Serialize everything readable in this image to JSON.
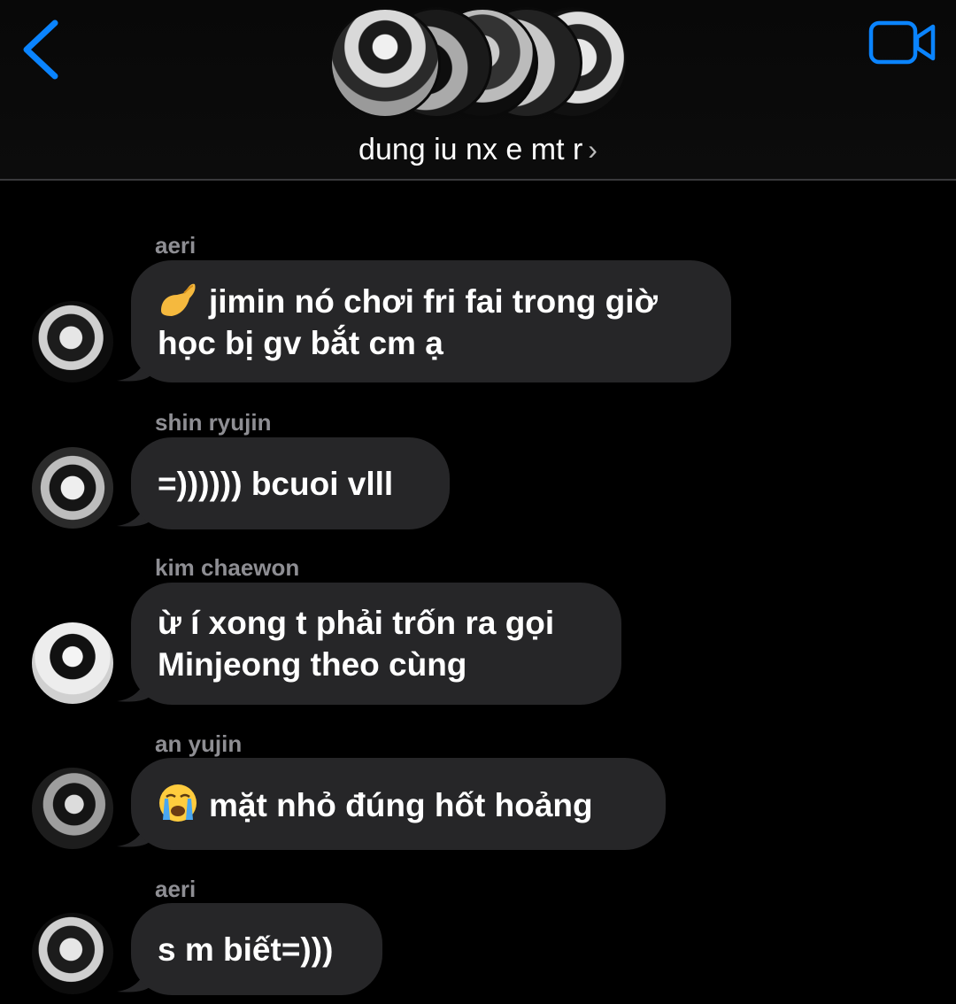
{
  "header": {
    "group_name": "dung iu nx e mt r",
    "chevron": "›",
    "back_icon": "chevron-left-icon",
    "video_icon": "video-camera-icon",
    "accent_color": "#0a84ff"
  },
  "messages": [
    {
      "sender": "aeri",
      "emoji": "pinching-hand",
      "line1": "jimin nó chơi fri fai trong giờ",
      "line2": "học bị gv bắt cm ạ"
    },
    {
      "sender": "shin ryujin",
      "text": "=)))))) bcuoi vlll"
    },
    {
      "sender": "kim chaewon",
      "line1": "ừ í xong t phải trốn ra gọi",
      "line2": "Minjeong theo cùng"
    },
    {
      "sender": "an yujin",
      "emoji": "loudly-crying-face",
      "text": "mặt nhỏ đúng hốt hoảng"
    },
    {
      "sender": "aeri",
      "text": "s m biết=)))"
    }
  ],
  "colors": {
    "bubble": "#262628",
    "sender_text": "#8e8e93",
    "background": "#000000"
  }
}
